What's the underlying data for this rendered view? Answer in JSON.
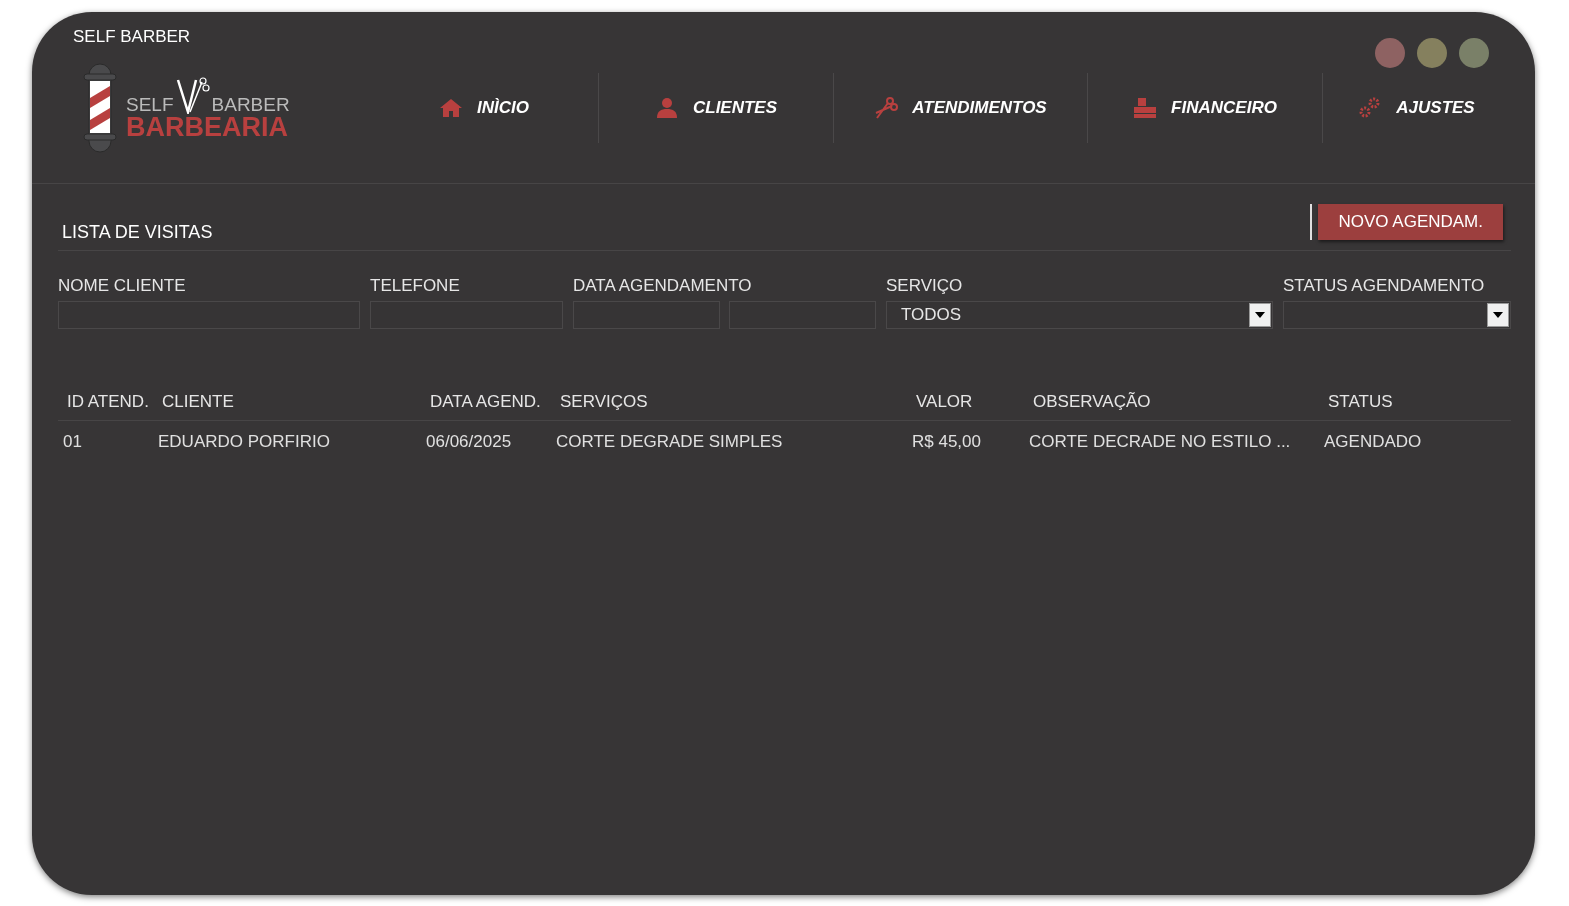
{
  "window": {
    "title": "SELF BARBER"
  },
  "logo": {
    "top_left": "SELF",
    "top_right": "BARBER",
    "bottom": "BARBEARIA"
  },
  "nav": [
    {
      "label": "INÌCIO"
    },
    {
      "label": "CLIENTES"
    },
    {
      "label": "ATENDIMENTOS"
    },
    {
      "label": "FINANCEIRO"
    },
    {
      "label": "AJUSTES"
    }
  ],
  "section": {
    "title": "LISTA DE VISITAS",
    "new_button": "NOVO AGENDAM."
  },
  "filters": [
    {
      "label": "NOME CLIENTE",
      "kind": "text"
    },
    {
      "label": "TELEFONE",
      "kind": "text"
    },
    {
      "label": "DATA AGENDAMENTO",
      "kind": "daterange"
    },
    {
      "label": "SERVIÇO",
      "kind": "select",
      "value": "TODOS"
    },
    {
      "label": "STATUS AGENDAMENTO",
      "kind": "select"
    }
  ],
  "table": {
    "columns": [
      "ID ATEND.",
      "CLIENTE",
      "DATA AGEND.",
      "SERVIÇOS",
      "VALOR",
      "OBSERVAÇÃO",
      "STATUS"
    ],
    "rows": [
      [
        "01",
        "EDUARDO PORFIRIO",
        "06/06/2025",
        "CORTE DEGRADE SIMPLES",
        "R$ 45,00",
        "CORTE DECRADE NO ESTILO ...",
        "AGENDADO"
      ]
    ]
  }
}
